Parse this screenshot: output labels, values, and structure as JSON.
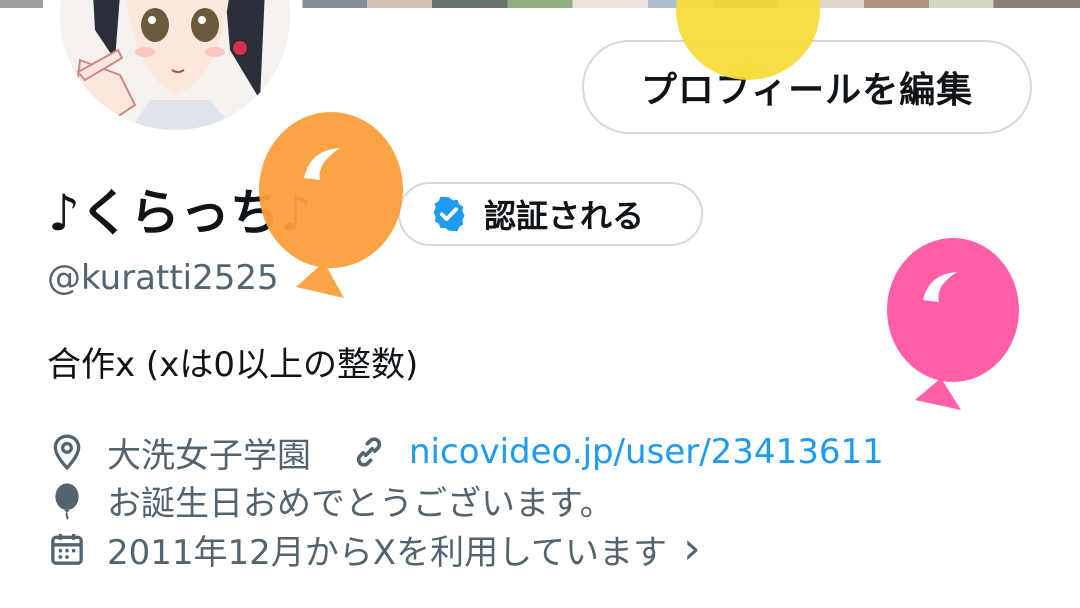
{
  "profile": {
    "edit_button_label": "プロフィールを編集",
    "display_name": "♪くらっち♪",
    "verify_button_label": "認証される",
    "handle": "@kuratti2525",
    "bio": "合作x (xは0以上の整数)"
  },
  "meta": {
    "location": "大洗女子学園",
    "url": "nicovideo.jp/user/23413611",
    "birthday": "お誕生日おめでとうございます。",
    "joined": "2011年12月からXを利用しています",
    "joined_chevron": "›"
  },
  "colors": {
    "accent": "#1d9bf0",
    "text": "#0f1419",
    "secondary": "#536471",
    "border": "#cfd9de",
    "balloon_yellow": "#f5dc3a",
    "balloon_orange": "#fb9e3d",
    "balloon_pink": "#ff5fa8"
  }
}
